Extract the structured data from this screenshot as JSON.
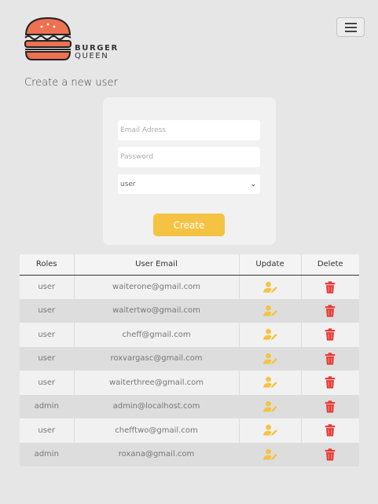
{
  "brand": {
    "name_line1": "BURGER",
    "name_line2": "QUEEN"
  },
  "header": {
    "menu_icon": "hamburger-menu-icon"
  },
  "create_user": {
    "title": "Create a new user",
    "email_placeholder": "Email Adress",
    "password_placeholder": "Password",
    "role_selected": "user",
    "create_label": "Create"
  },
  "table": {
    "headers": [
      "Roles",
      "User Email",
      "Update",
      "Delete"
    ],
    "rows": [
      {
        "role": "user",
        "email": "waiterone@gmail.com"
      },
      {
        "role": "user",
        "email": "waitertwo@gmail.com"
      },
      {
        "role": "user",
        "email": "cheff@gmail.com"
      },
      {
        "role": "user",
        "email": "roxvargasc@gmail.com"
      },
      {
        "role": "user",
        "email": "waiterthree@gmail.com"
      },
      {
        "role": "admin",
        "email": "admin@localhost.com"
      },
      {
        "role": "user",
        "email": "chefftwo@gmail.com"
      },
      {
        "role": "admin",
        "email": "roxana@gmail.com"
      }
    ]
  },
  "colors": {
    "accent": "#f5c343",
    "logo_orange": "#ee7151",
    "delete_red": "#e53935",
    "background": "#e6e6e6"
  },
  "icons": {
    "update": "user-edit-icon",
    "delete": "trash-icon"
  }
}
